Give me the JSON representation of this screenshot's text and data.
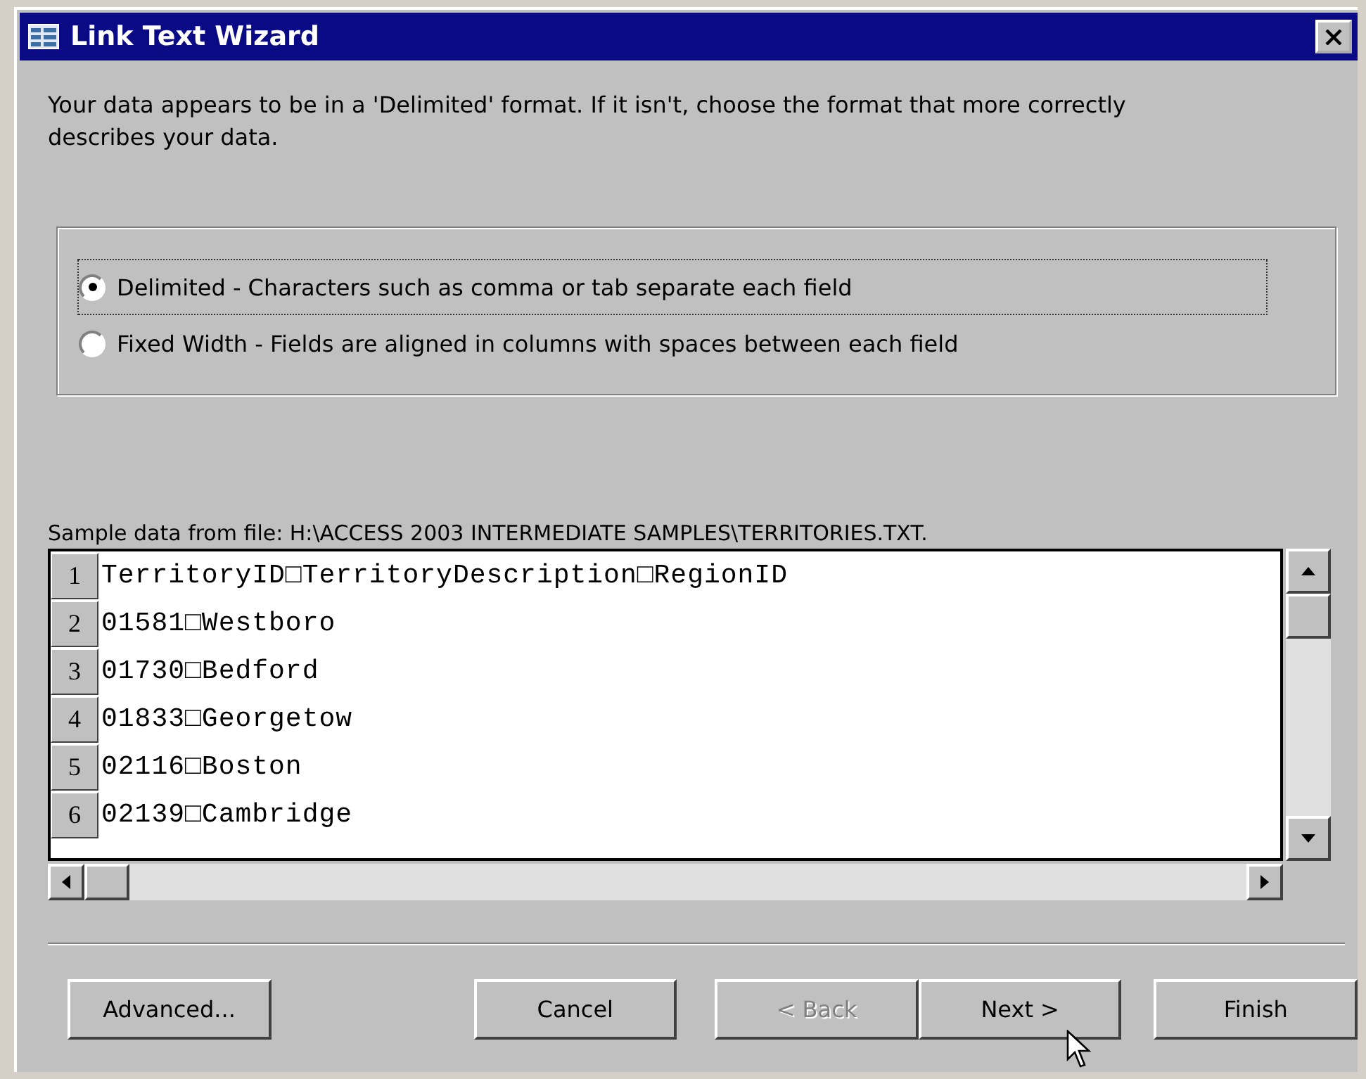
{
  "window": {
    "title": "Link Text Wizard"
  },
  "intro": "Your data appears to be in a 'Delimited' format. If it isn't, choose the format that more correctly describes your data.",
  "formats": [
    {
      "label": "Delimited - Characters such as comma or tab separate each field",
      "selected": true,
      "focused": true
    },
    {
      "label": "Fixed Width - Fields are aligned in columns with spaces between each field",
      "selected": false,
      "focused": false
    }
  ],
  "sample": {
    "caption": "Sample data from file: H:\\ACCESS 2003 INTERMEDIATE SAMPLES\\TERRITORIES.TXT.",
    "rows": [
      {
        "number": "1",
        "text": "TerritoryID□TerritoryDescription□RegionID"
      },
      {
        "number": "2",
        "text": "01581□Westboro"
      },
      {
        "number": "3",
        "text": "01730□Bedford"
      },
      {
        "number": "4",
        "text": "01833□Georgetow"
      },
      {
        "number": "5",
        "text": "02116□Boston"
      },
      {
        "number": "6",
        "text": "02139□Cambridge"
      }
    ]
  },
  "buttons": [
    {
      "label": "Advanced...",
      "kind": "advanced",
      "disabled": false
    },
    {
      "label": "Cancel",
      "kind": "cancel",
      "disabled": false
    },
    {
      "label": "< Back",
      "kind": "back",
      "disabled": true
    },
    {
      "label": "Next >",
      "kind": "next",
      "disabled": false
    },
    {
      "label": "Finish",
      "kind": "finish",
      "disabled": false
    }
  ]
}
